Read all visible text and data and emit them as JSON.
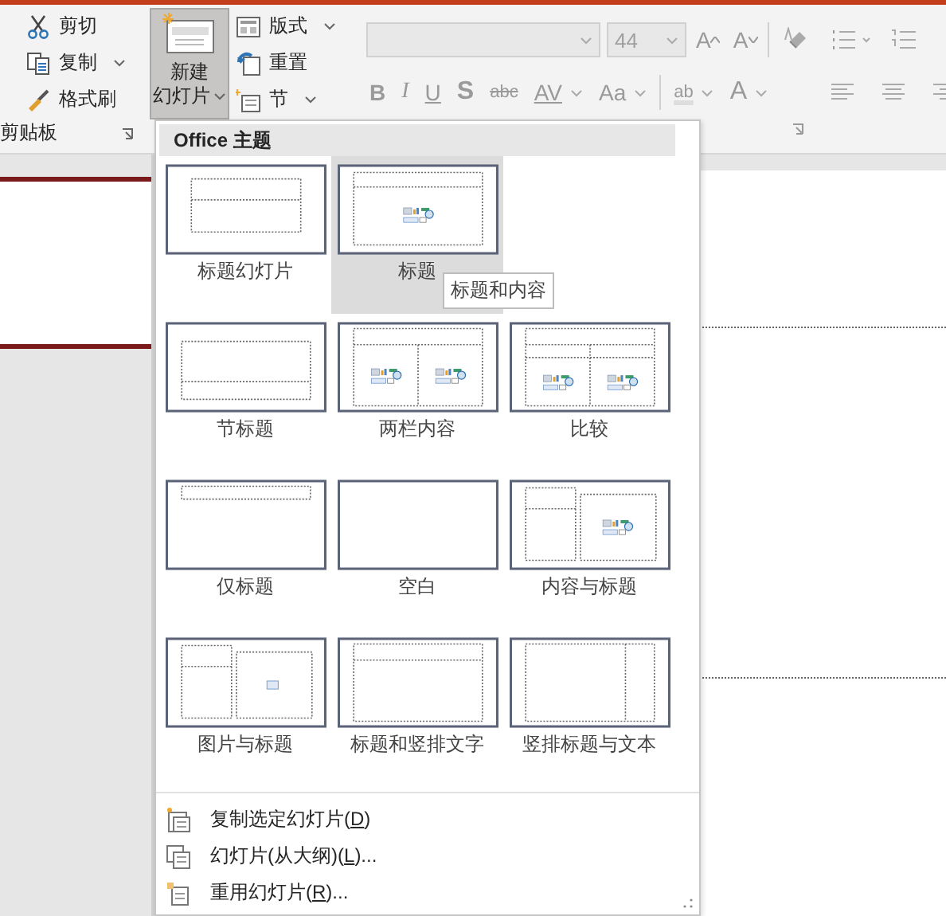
{
  "ribbon": {
    "clipboard": {
      "items": [
        {
          "label": "剪切",
          "kind": "cut"
        },
        {
          "label": "复制",
          "kind": "copy",
          "dropdown": true
        },
        {
          "label": "格式刷",
          "kind": "brush"
        }
      ],
      "group_label": "剪贴板"
    },
    "slides": {
      "new_slide": {
        "lines": [
          "新建",
          "幻灯片"
        ],
        "pressed": true
      },
      "items": [
        {
          "label": "版式",
          "kind": "layout",
          "dropdown": true
        },
        {
          "label": "重置",
          "kind": "reset",
          "dropdown": false
        },
        {
          "label": "节",
          "kind": "section",
          "dropdown": true
        }
      ]
    },
    "font": {
      "disabled": true,
      "font_size": "44",
      "size_buttons": [
        {
          "label": "A",
          "kind": "grow"
        },
        {
          "label": "A",
          "kind": "shrink"
        }
      ],
      "format_buttons": [
        {
          "label": "B",
          "kind": "bold",
          "dropdown": false
        },
        {
          "label": "I",
          "kind": "italic",
          "dropdown": false
        },
        {
          "label": "U",
          "kind": "underline",
          "dropdown": false
        },
        {
          "label": "S",
          "kind": "shadow",
          "dropdown": false
        },
        {
          "label": "abc",
          "kind": "strike",
          "dropdown": false
        },
        {
          "label": "AV",
          "kind": "spacing",
          "dropdown": true
        },
        {
          "label": "Aa",
          "kind": "case",
          "dropdown": true
        }
      ],
      "color_buttons": [
        {
          "label": "ab",
          "kind": "highlight"
        },
        {
          "label": "A",
          "kind": "color"
        }
      ]
    }
  },
  "menu": {
    "header": "Office 主题",
    "layouts": [
      {
        "label": "标题幻灯片",
        "kind": "title",
        "selected": false
      },
      {
        "label": "标题",
        "kind": "title-content",
        "selected": true
      },
      {
        "label": "节标题",
        "kind": "section",
        "selected": false
      },
      {
        "label": "两栏内容",
        "kind": "two-content",
        "selected": false
      },
      {
        "label": "比较",
        "kind": "comparison",
        "selected": false
      },
      {
        "label": "仅标题",
        "kind": "title-only",
        "selected": false
      },
      {
        "label": "空白",
        "kind": "blank",
        "selected": false
      },
      {
        "label": "内容与标题",
        "kind": "content-caption",
        "selected": false
      },
      {
        "label": "图片与标题",
        "kind": "picture-caption",
        "selected": false
      },
      {
        "label": "标题和竖排文字",
        "kind": "title-vertical",
        "selected": false
      },
      {
        "label": "竖排标题与文本",
        "kind": "vertical-title",
        "selected": false
      }
    ],
    "tooltip": "标题和内容",
    "commands": [
      {
        "before": "复制选定幻灯片(",
        "key": "D",
        "after": ")",
        "kind": "duplicate"
      },
      {
        "before": "幻灯片(从大纲)(",
        "key": "L",
        "after": ")...",
        "kind": "outline"
      },
      {
        "before": "重用幻灯片(",
        "key": "R",
        "after": ")...",
        "kind": "reuse"
      }
    ]
  }
}
